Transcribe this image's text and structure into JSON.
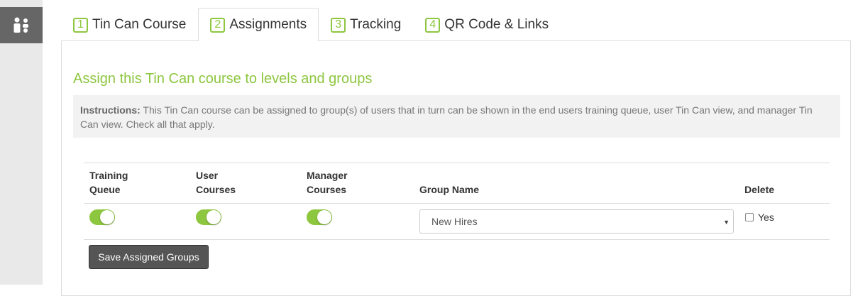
{
  "sidebar": {
    "icon": "users-icon"
  },
  "tabs": [
    {
      "number": "1",
      "label": "Tin Can Course",
      "active": false
    },
    {
      "number": "2",
      "label": "Assignments",
      "active": true
    },
    {
      "number": "3",
      "label": "Tracking",
      "active": false
    },
    {
      "number": "4",
      "label": "QR Code & Links",
      "active": false
    }
  ],
  "section": {
    "title": "Assign this Tin Can course to levels and groups"
  },
  "instructions": {
    "label": "Instructions:",
    "text": " This Tin Can course can be assigned to group(s) of users that in turn can be shown in the end users training queue, user Tin Can view, and manager Tin Can view. Check all that apply."
  },
  "table": {
    "headers": {
      "training_queue_1": "Training",
      "training_queue_2": "Queue",
      "user_courses_1": "User",
      "user_courses_2": "Courses",
      "manager_courses_1": "Manager",
      "manager_courses_2": "Courses",
      "group_name": "Group Name",
      "delete": "Delete"
    },
    "rows": [
      {
        "training_queue": true,
        "user_courses": true,
        "manager_courses": true,
        "group_name": "New Hires",
        "delete_label": "Yes",
        "delete_checked": false
      }
    ]
  },
  "actions": {
    "save_label": "Save Assigned Groups"
  },
  "colors": {
    "accent": "#8dc63f",
    "button_bg": "#555555"
  }
}
